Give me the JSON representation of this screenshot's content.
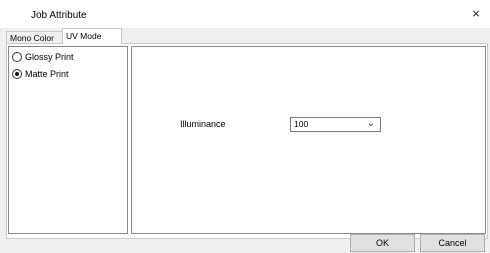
{
  "window": {
    "title": "Job Attribute",
    "close_glyph": "×"
  },
  "tabs": [
    {
      "label": "Mono Color",
      "selected": false
    },
    {
      "label": "UV Mode",
      "selected": true
    }
  ],
  "print_modes": [
    {
      "label": "Glossy Print",
      "selected": false
    },
    {
      "label": "Matte Print",
      "selected": true
    }
  ],
  "illuminance": {
    "label": "Illuminance",
    "value": "100"
  },
  "buttons": {
    "ok": "OK",
    "cancel": "Cancel"
  }
}
